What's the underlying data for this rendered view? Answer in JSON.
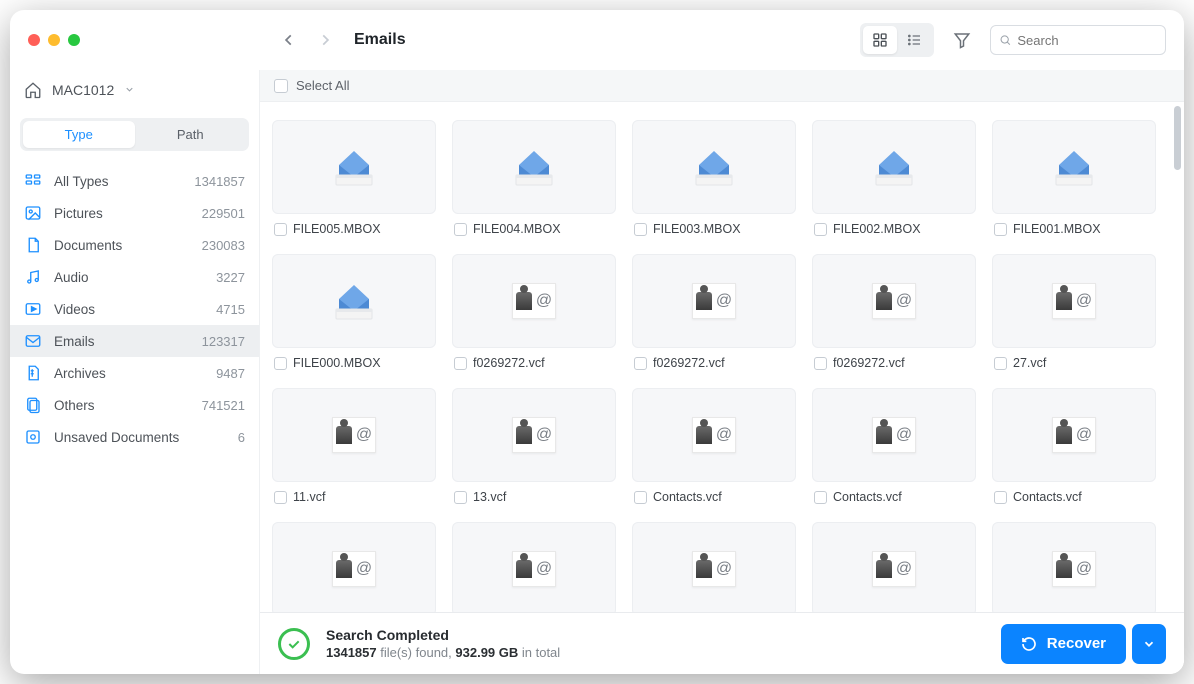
{
  "breadcrumb": {
    "title": "Emails"
  },
  "search": {
    "placeholder": "Search"
  },
  "location": {
    "name": "MAC1012"
  },
  "tabs": {
    "type": "Type",
    "path": "Path"
  },
  "selectAllLabel": "Select All",
  "categories": [
    {
      "label": "All Types",
      "count": "1341857"
    },
    {
      "label": "Pictures",
      "count": "229501"
    },
    {
      "label": "Documents",
      "count": "230083"
    },
    {
      "label": "Audio",
      "count": "3227"
    },
    {
      "label": "Videos",
      "count": "4715"
    },
    {
      "label": "Emails",
      "count": "123317"
    },
    {
      "label": "Archives",
      "count": "9487"
    },
    {
      "label": "Others",
      "count": "741521"
    },
    {
      "label": "Unsaved Documents",
      "count": "6"
    }
  ],
  "files": [
    {
      "name": "FILE005.MBOX",
      "kind": "mbox"
    },
    {
      "name": "FILE004.MBOX",
      "kind": "mbox"
    },
    {
      "name": "FILE003.MBOX",
      "kind": "mbox"
    },
    {
      "name": "FILE002.MBOX",
      "kind": "mbox"
    },
    {
      "name": "FILE001.MBOX",
      "kind": "mbox"
    },
    {
      "name": "FILE000.MBOX",
      "kind": "mbox"
    },
    {
      "name": "f0269272.vcf",
      "kind": "vcf"
    },
    {
      "name": "f0269272.vcf",
      "kind": "vcf"
    },
    {
      "name": "f0269272.vcf",
      "kind": "vcf"
    },
    {
      "name": "27.vcf",
      "kind": "vcf"
    },
    {
      "name": "11.vcf",
      "kind": "vcf"
    },
    {
      "name": "13.vcf",
      "kind": "vcf"
    },
    {
      "name": "Contacts.vcf",
      "kind": "vcf"
    },
    {
      "name": "Contacts.vcf",
      "kind": "vcf"
    },
    {
      "name": "Contacts.vcf",
      "kind": "vcf"
    },
    {
      "name": "",
      "kind": "vcf"
    },
    {
      "name": "",
      "kind": "vcf"
    },
    {
      "name": "",
      "kind": "vcf"
    },
    {
      "name": "",
      "kind": "vcf"
    },
    {
      "name": "",
      "kind": "vcf"
    }
  ],
  "status": {
    "title": "Search Completed",
    "count": "1341857",
    "middle": " file(s) found, ",
    "size": "932.99 GB",
    "tail": " in total"
  },
  "recover": {
    "label": "Recover"
  }
}
